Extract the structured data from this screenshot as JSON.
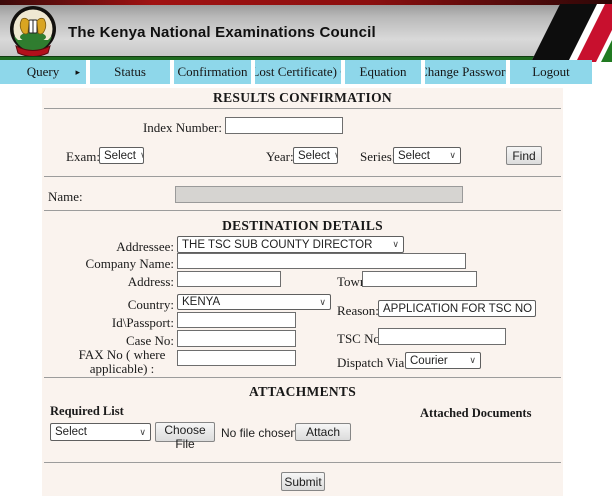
{
  "header": {
    "title": "The Kenya National Examinations Council",
    "logo": "knec-coat-of-arms"
  },
  "nav": {
    "items": [
      {
        "label": "Query",
        "has_submenu": true
      },
      {
        "label": "Status"
      },
      {
        "label": "Confirmation"
      },
      {
        "label": "(Lost Certificate) C"
      },
      {
        "label": "Equation"
      },
      {
        "label": "Change Password"
      },
      {
        "label": "Logout"
      }
    ]
  },
  "results_confirmation": {
    "title": "RESULTS CONFIRMATION",
    "index_number_label": "Index Number:",
    "exam_label": "Exam:",
    "exam_value": "Select",
    "year_label": "Year:",
    "year_value": "Select",
    "series_label": "Series:",
    "series_value": "Select",
    "find_button": "Find",
    "name_label": "Name:"
  },
  "destination_details": {
    "title": "DESTINATION DETAILS",
    "addressee_label": "Addressee:",
    "addressee_value": "THE TSC SUB COUNTY DIRECTOR",
    "company_name_label": "Company Name:",
    "address_label": "Address:",
    "town_label": "Town:",
    "country_label": "Country:",
    "country_value": "KENYA",
    "reason_label": "Reason:",
    "reason_value": "APPLICATION FOR TSC NO",
    "id_passport_label": "Id\\Passport:",
    "case_no_label": "Case No:",
    "tsc_no_label": "TSC No:",
    "fax_label": "FAX No ( where applicable) :",
    "dispatch_label": "Dispatch Via :",
    "dispatch_value": "Courier"
  },
  "attachments": {
    "title": "ATTACHMENTS",
    "required_list_label": "Required List",
    "attached_documents_label": "Attached Documents",
    "required_select_value": "Select",
    "choose_file_button": "Choose File",
    "no_file_text": "No file chosen",
    "attach_button": "Attach"
  },
  "submit_button": "Submit",
  "colors": {
    "nav_blue": "#8ed7ea",
    "form_bg": "#faf3ee",
    "flag_red": "#c8102e",
    "flag_green": "#217a21",
    "header_green_line": "#1f6b1f",
    "top_red_line": "#8c1010"
  }
}
